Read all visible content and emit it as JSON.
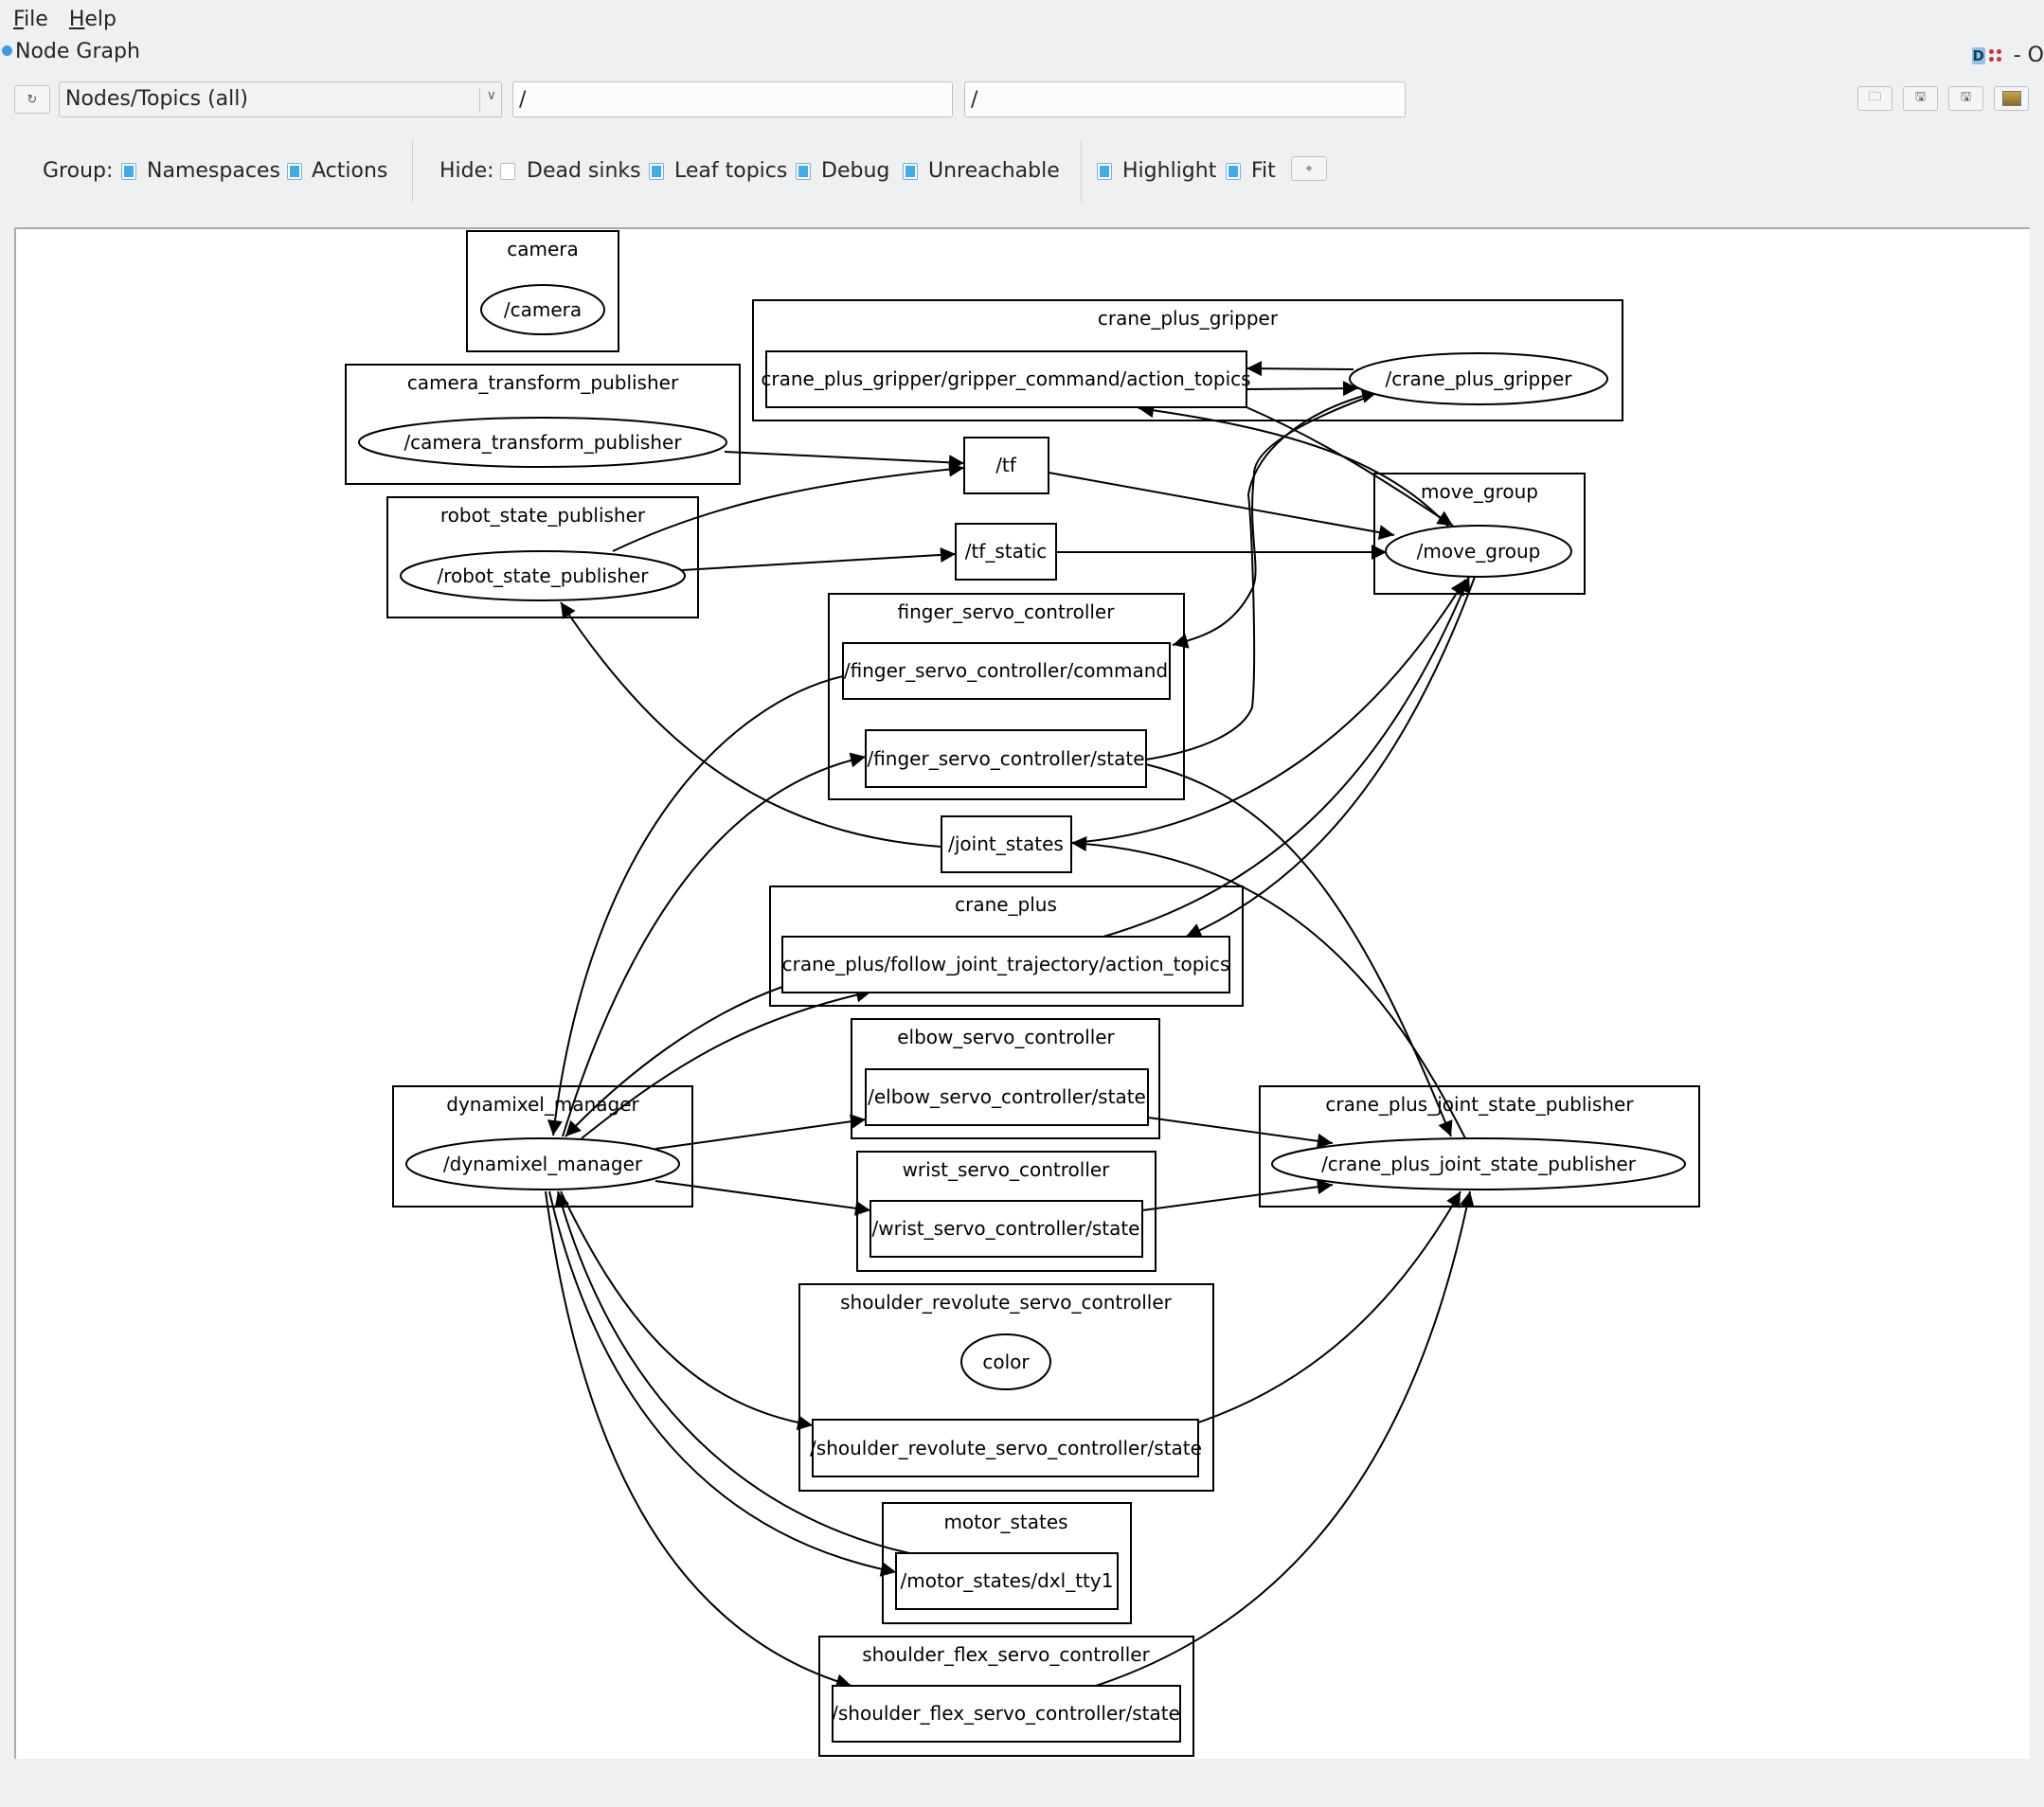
{
  "menu": {
    "items": [
      {
        "label": "File",
        "mnemonic": "F",
        "rest": "ile"
      },
      {
        "label": "Help",
        "mnemonic": "H",
        "rest": "elp"
      }
    ]
  },
  "window": {
    "title": "Node Graph",
    "title_right_text": "- O"
  },
  "toolbar": {
    "refresh_icon": "refresh-icon",
    "graph_type_selected": "Nodes/Topics (all)",
    "node_filter_value": "/",
    "topic_filter_value": "/",
    "right_buttons": [
      "open-icon",
      "save-dot-icon",
      "save-svg-icon",
      "save-image-icon"
    ]
  },
  "options": {
    "group_label": "Group:",
    "group": [
      {
        "label": "Namespaces",
        "checked": true
      },
      {
        "label": "Actions",
        "checked": true
      }
    ],
    "hide_label": "Hide:",
    "hide": [
      {
        "label": "Dead sinks",
        "checked": false
      },
      {
        "label": "Leaf topics",
        "checked": true
      },
      {
        "label": "Debug",
        "checked": true
      },
      {
        "label": "Unreachable",
        "checked": true
      }
    ],
    "view": [
      {
        "label": "Highlight",
        "checked": true
      },
      {
        "label": "Fit",
        "checked": true
      }
    ],
    "fit_button_icon": "fit-view-icon"
  },
  "graph": {
    "clusters": [
      {
        "id": "c_camera",
        "label": "camera"
      },
      {
        "id": "c_ctp",
        "label": "camera_transform_publisher"
      },
      {
        "id": "c_rsp",
        "label": "robot_state_publisher"
      },
      {
        "id": "c_gripper",
        "label": "crane_plus_gripper"
      },
      {
        "id": "c_move",
        "label": "move_group"
      },
      {
        "id": "c_finger",
        "label": "finger_servo_controller"
      },
      {
        "id": "c_crane",
        "label": "crane_plus"
      },
      {
        "id": "c_elbow",
        "label": "elbow_servo_controller"
      },
      {
        "id": "c_wrist",
        "label": "wrist_servo_controller"
      },
      {
        "id": "c_dyn",
        "label": "dynamixel_manager"
      },
      {
        "id": "c_cpjsp",
        "label": "crane_plus_joint_state_publisher"
      },
      {
        "id": "c_shrev",
        "label": "shoulder_revolute_servo_controller"
      },
      {
        "id": "c_motor",
        "label": "motor_states"
      },
      {
        "id": "c_shflex",
        "label": "shoulder_flex_servo_controller"
      }
    ],
    "nodes": [
      {
        "id": "n_camera",
        "label": "/camera",
        "kind": "node"
      },
      {
        "id": "n_ctp",
        "label": "/camera_transform_publisher",
        "kind": "node"
      },
      {
        "id": "n_rsp",
        "label": "/robot_state_publisher",
        "kind": "node"
      },
      {
        "id": "n_gripper",
        "label": "/crane_plus_gripper",
        "kind": "node"
      },
      {
        "id": "n_move",
        "label": "/move_group",
        "kind": "node"
      },
      {
        "id": "n_dyn",
        "label": "/dynamixel_manager",
        "kind": "node"
      },
      {
        "id": "n_cpjsp",
        "label": "/crane_plus_joint_state_publisher",
        "kind": "node"
      },
      {
        "id": "n_color",
        "label": "color",
        "kind": "node"
      }
    ],
    "topics": [
      {
        "id": "t_tf",
        "label": "/tf"
      },
      {
        "id": "t_tfs",
        "label": "/tf_static"
      },
      {
        "id": "t_gripcmd",
        "label": "crane_plus_gripper/gripper_command/action_topics"
      },
      {
        "id": "t_fcmd",
        "label": "/finger_servo_controller/command"
      },
      {
        "id": "t_fstate",
        "label": "/finger_servo_controller/state"
      },
      {
        "id": "t_js",
        "label": "/joint_states"
      },
      {
        "id": "t_fjt",
        "label": "crane_plus/follow_joint_trajectory/action_topics"
      },
      {
        "id": "t_elbow",
        "label": "/elbow_servo_controller/state"
      },
      {
        "id": "t_wrist",
        "label": "/wrist_servo_controller/state"
      },
      {
        "id": "t_shrev",
        "label": "/shoulder_revolute_servo_controller/state"
      },
      {
        "id": "t_motor",
        "label": "/motor_states/dxl_tty1"
      },
      {
        "id": "t_shflex",
        "label": "/shoulder_flex_servo_controller/state"
      }
    ],
    "edges": [
      {
        "from": "/camera_transform_publisher",
        "to": "/tf"
      },
      {
        "from": "/robot_state_publisher",
        "to": "/tf"
      },
      {
        "from": "/robot_state_publisher",
        "to": "/tf_static"
      },
      {
        "from": "/tf",
        "to": "/move_group"
      },
      {
        "from": "/tf_static",
        "to": "/move_group"
      },
      {
        "from": "/crane_plus_gripper",
        "to": "crane_plus_gripper/gripper_command/action_topics"
      },
      {
        "from": "crane_plus_gripper/gripper_command/action_topics",
        "to": "/crane_plus_gripper"
      },
      {
        "from": "crane_plus_gripper/gripper_command/action_topics",
        "to": "/move_group"
      },
      {
        "from": "/move_group",
        "to": "crane_plus_gripper/gripper_command/action_topics"
      },
      {
        "from": "/crane_plus_gripper",
        "to": "/finger_servo_controller/command"
      },
      {
        "from": "/finger_servo_controller/state",
        "to": "/crane_plus_gripper"
      },
      {
        "from": "/finger_servo_controller/command",
        "to": "/dynamixel_manager"
      },
      {
        "from": "/dynamixel_manager",
        "to": "/finger_servo_controller/state"
      },
      {
        "from": "/finger_servo_controller/state",
        "to": "/crane_plus_joint_state_publisher"
      },
      {
        "from": "/joint_states",
        "to": "/robot_state_publisher"
      },
      {
        "from": "/joint_states",
        "to": "/move_group"
      },
      {
        "from": "/crane_plus_joint_state_publisher",
        "to": "/joint_states"
      },
      {
        "from": "crane_plus/follow_joint_trajectory/action_topics",
        "to": "/move_group"
      },
      {
        "from": "/move_group",
        "to": "crane_plus/follow_joint_trajectory/action_topics"
      },
      {
        "from": "crane_plus/follow_joint_trajectory/action_topics",
        "to": "/dynamixel_manager"
      },
      {
        "from": "/dynamixel_manager",
        "to": "crane_plus/follow_joint_trajectory/action_topics"
      },
      {
        "from": "/dynamixel_manager",
        "to": "/elbow_servo_controller/state"
      },
      {
        "from": "/dynamixel_manager",
        "to": "/wrist_servo_controller/state"
      },
      {
        "from": "/elbow_servo_controller/state",
        "to": "/crane_plus_joint_state_publisher"
      },
      {
        "from": "/wrist_servo_controller/state",
        "to": "/crane_plus_joint_state_publisher"
      },
      {
        "from": "/dynamixel_manager",
        "to": "/shoulder_revolute_servo_controller/state"
      },
      {
        "from": "/shoulder_revolute_servo_controller/state",
        "to": "/crane_plus_joint_state_publisher"
      },
      {
        "from": "/dynamixel_manager",
        "to": "/motor_states/dxl_tty1"
      },
      {
        "from": "/motor_states/dxl_tty1",
        "to": "/dynamixel_manager"
      },
      {
        "from": "/dynamixel_manager",
        "to": "/shoulder_flex_servo_controller/state"
      },
      {
        "from": "/shoulder_flex_servo_controller/state",
        "to": "/crane_plus_joint_state_publisher"
      }
    ]
  }
}
